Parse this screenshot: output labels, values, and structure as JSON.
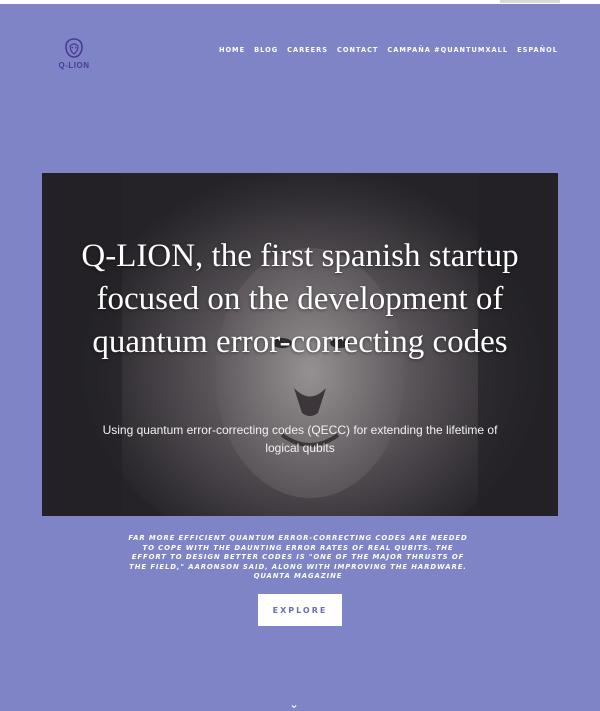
{
  "brand": {
    "name": "Q-LION"
  },
  "nav": {
    "items": [
      "HOME",
      "BLOG",
      "CAREERS",
      "CONTACT",
      "CAMPAÑA #QUANTUMXALL",
      "ESPAÑOL"
    ]
  },
  "hero": {
    "title": "Q-LION, the first spanish startup focused on the development of quantum error-correcting codes",
    "subtitle": "Using quantum error-correcting codes (QECC) for extending the lifetime of logical qubits"
  },
  "quote": {
    "text": "FAR MORE EFFICIENT QUANTUM ERROR-CORRECTING CODES ARE NEEDED TO COPE WITH THE DAUNTING ERROR RATES OF REAL QUBITS. THE EFFORT TO DESIGN BETTER CODES IS \"ONE OF THE MAJOR THRUSTS OF THE FIELD,\" AARONSON SAID, ALONG WITH IMPROVING THE HARDWARE.",
    "source": "QUANTA MAGAZINE"
  },
  "cta": {
    "label": "EXPLORE"
  },
  "colors": {
    "background": "#7f84c6",
    "logo": "#4a3a98",
    "button_text": "#6a6fb8"
  }
}
